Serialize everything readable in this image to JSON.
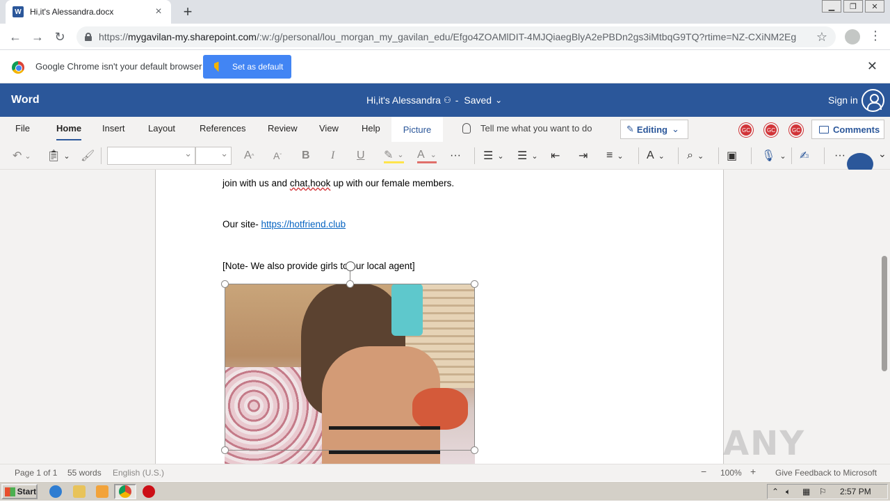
{
  "browser": {
    "tab_title": "Hi,it's Alessandra.docx",
    "tab_favicon": "W",
    "url_prefix": "https://",
    "url_host": "mygavilan-my.sharepoint.com",
    "url_path": "/:w:/g/personal/lou_morgan_my_gavilan_edu/Efgo4ZOAMlDIT-4MJQiaegBlyA2ePBDn2gs3iMtbqG9TQ?rtime=NZ-CXiNM2Eg",
    "infobar_text": "Google Chrome isn't your default browser",
    "set_default_label": "Set as default"
  },
  "word": {
    "app_name": "Word",
    "doc_title": "Hi,it's Alessandra",
    "separator": "-",
    "save_status": "Saved",
    "sign_in": "Sign in",
    "tabs": [
      "File",
      "Home",
      "Insert",
      "Layout",
      "References",
      "Review",
      "View",
      "Help"
    ],
    "contextual_tab": "Picture",
    "tell_me": "Tell me what you want to do",
    "editing_label": "Editing",
    "coauthors": [
      "GC",
      "GC",
      "GC"
    ],
    "comments_label": "Comments"
  },
  "document": {
    "line1_a": "join with us and ",
    "line1_squiggle": "chat,hook",
    "line1_b": " up with our female members.",
    "line2_prefix": "Our site- ",
    "line2_link": "https://hotfriend.club",
    "line3": "[Note- We also provide girls to our local agent]"
  },
  "status": {
    "page": "Page 1 of 1",
    "words": "55 words",
    "language": "English (U.S.)",
    "zoom": "100%",
    "feedback": "Give Feedback to Microsoft"
  },
  "taskbar": {
    "start_label": "Start",
    "clock": "2:57 PM"
  },
  "watermark": "ANY RUN",
  "colors": {
    "word_blue": "#2b579a",
    "chrome_button": "#4285f4",
    "coauthor_red": "#d13438",
    "link": "#0563c1"
  }
}
